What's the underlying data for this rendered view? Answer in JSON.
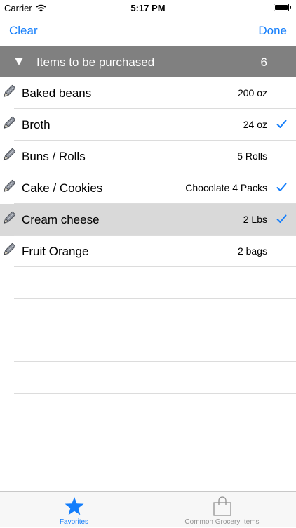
{
  "status_bar": {
    "carrier": "Carrier",
    "time": "5:17 PM"
  },
  "nav": {
    "left_label": "Clear",
    "right_label": "Done"
  },
  "section": {
    "title": "Items to be purchased",
    "count": "6"
  },
  "items": [
    {
      "name": "Baked beans",
      "quantity": "200 oz",
      "checked": false,
      "selected": false
    },
    {
      "name": "Broth",
      "quantity": "24 oz",
      "checked": true,
      "selected": false
    },
    {
      "name": "Buns / Rolls",
      "quantity": "5 Rolls",
      "checked": false,
      "selected": false
    },
    {
      "name": "Cake / Cookies",
      "quantity": "Chocolate 4 Packs",
      "checked": true,
      "selected": false
    },
    {
      "name": "Cream cheese",
      "quantity": "2 Lbs",
      "checked": true,
      "selected": true
    },
    {
      "name": "Fruit Orange",
      "quantity": "2 bags",
      "checked": false,
      "selected": false
    }
  ],
  "tabs": [
    {
      "label": "Favorites",
      "icon": "star-icon",
      "active": true
    },
    {
      "label": "Common Grocery Items",
      "icon": "shopping-bag-icon",
      "active": false
    }
  ],
  "colors": {
    "accent": "#147efb",
    "section_header_bg": "#808080",
    "selected_row_bg": "#d9d9d9"
  }
}
